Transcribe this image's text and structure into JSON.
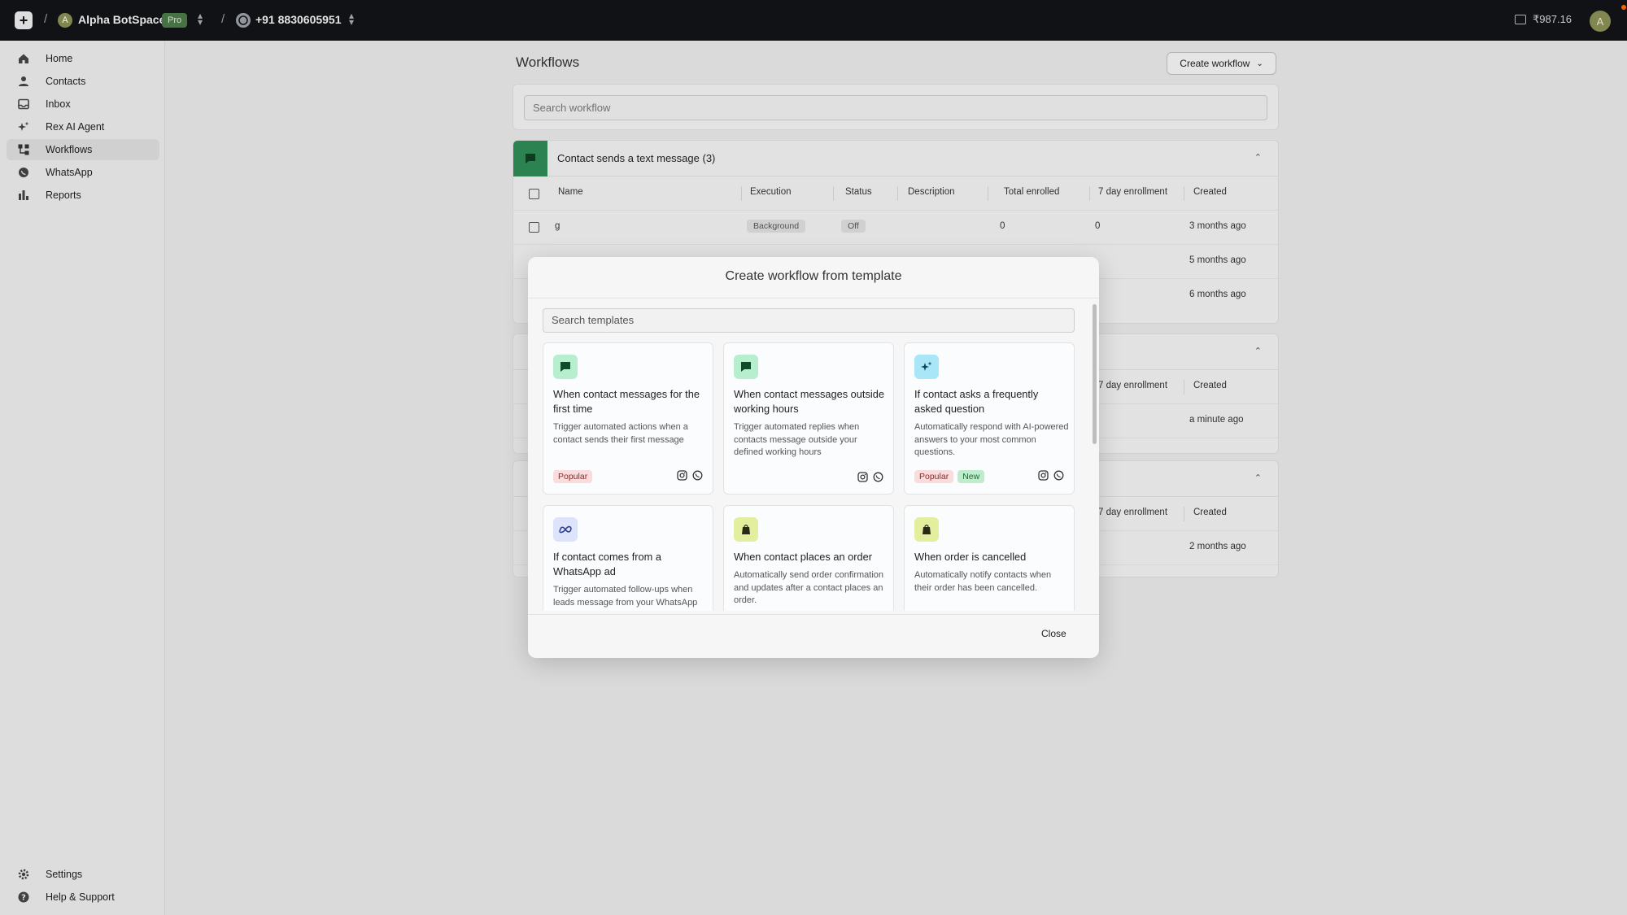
{
  "topbar": {
    "workspace_initial": "A",
    "workspace_name": "Alpha BotSpace",
    "plan_badge": "Pro",
    "phone_number": "+91 8830605951",
    "balance": "₹987.16",
    "user_initial": "A",
    "separator": "/"
  },
  "sidebar": {
    "items": [
      {
        "label": "Home",
        "icon": "home-icon"
      },
      {
        "label": "Contacts",
        "icon": "user-icon"
      },
      {
        "label": "Inbox",
        "icon": "inbox-icon"
      },
      {
        "label": "Rex AI Agent",
        "icon": "sparkle-icon"
      },
      {
        "label": "Workflows",
        "icon": "workflow-icon",
        "active": true
      },
      {
        "label": "WhatsApp",
        "icon": "whatsapp-icon"
      },
      {
        "label": "Reports",
        "icon": "bar-chart-icon"
      }
    ],
    "bottom": [
      {
        "label": "Settings",
        "icon": "gear-icon"
      },
      {
        "label": "Help & Support",
        "icon": "help-icon"
      }
    ]
  },
  "page": {
    "title": "Workflows",
    "create_label": "Create workflow",
    "search_placeholder": "Search workflow"
  },
  "group1": {
    "title": "Contact sends a text message (3)",
    "columns": [
      "Name",
      "Execution",
      "Status",
      "Description",
      "Total enrolled",
      "7 day enrollment",
      "Created"
    ],
    "rows": [
      {
        "name": "g",
        "execution": "Background",
        "status": "Off",
        "description": "",
        "total": "0",
        "seven_day": "0",
        "created": "3 months ago"
      }
    ],
    "more_created": [
      "5 months ago",
      "6 months ago"
    ]
  },
  "group2": {
    "col_seven_day": "7 day enrollment",
    "col_created": "Created",
    "created": "a minute ago"
  },
  "group3": {
    "col_seven_day": "7 day enrollment",
    "col_created": "Created",
    "created": "2 months ago"
  },
  "modal": {
    "title": "Create workflow from template",
    "search_placeholder": "Search templates",
    "close_label": "Close",
    "cards": [
      {
        "title": "When contact messages for the first time",
        "desc": "Trigger automated actions when a contact sends their first message",
        "badges": [
          "Popular"
        ],
        "icon": "chat-icon"
      },
      {
        "title": "When contact messages outside working hours",
        "desc": "Trigger automated replies when contacts message outside your defined working hours",
        "badges": [],
        "icon": "chat-icon"
      },
      {
        "title": "If contact asks a frequently asked question",
        "desc": "Automatically respond with AI-powered answers to your most common questions.",
        "badges": [
          "Popular",
          "New"
        ],
        "icon": "sparkle-icon"
      },
      {
        "title": "If contact comes from a WhatsApp ad",
        "desc": "Trigger automated follow-ups when leads message from your WhatsApp ad",
        "badges": [],
        "icon": "meta-icon"
      },
      {
        "title": "When contact places an order",
        "desc": "Automatically send order confirmation and updates after a contact places an order.",
        "badges": [],
        "icon": "shopify-icon"
      },
      {
        "title": "When order is cancelled",
        "desc": "Automatically notify contacts when their order has been cancelled.",
        "badges": [],
        "icon": "shopify-icon"
      }
    ]
  },
  "colors": {
    "topbar": "#121417",
    "chat_icon_bg": "#b7efce",
    "sparkle_icon_bg": "#a9e6f7",
    "meta_icon_bg": "#dde3fb",
    "shopify_icon_bg": "#e3ef9e",
    "group_icon": "#2f8a55"
  }
}
